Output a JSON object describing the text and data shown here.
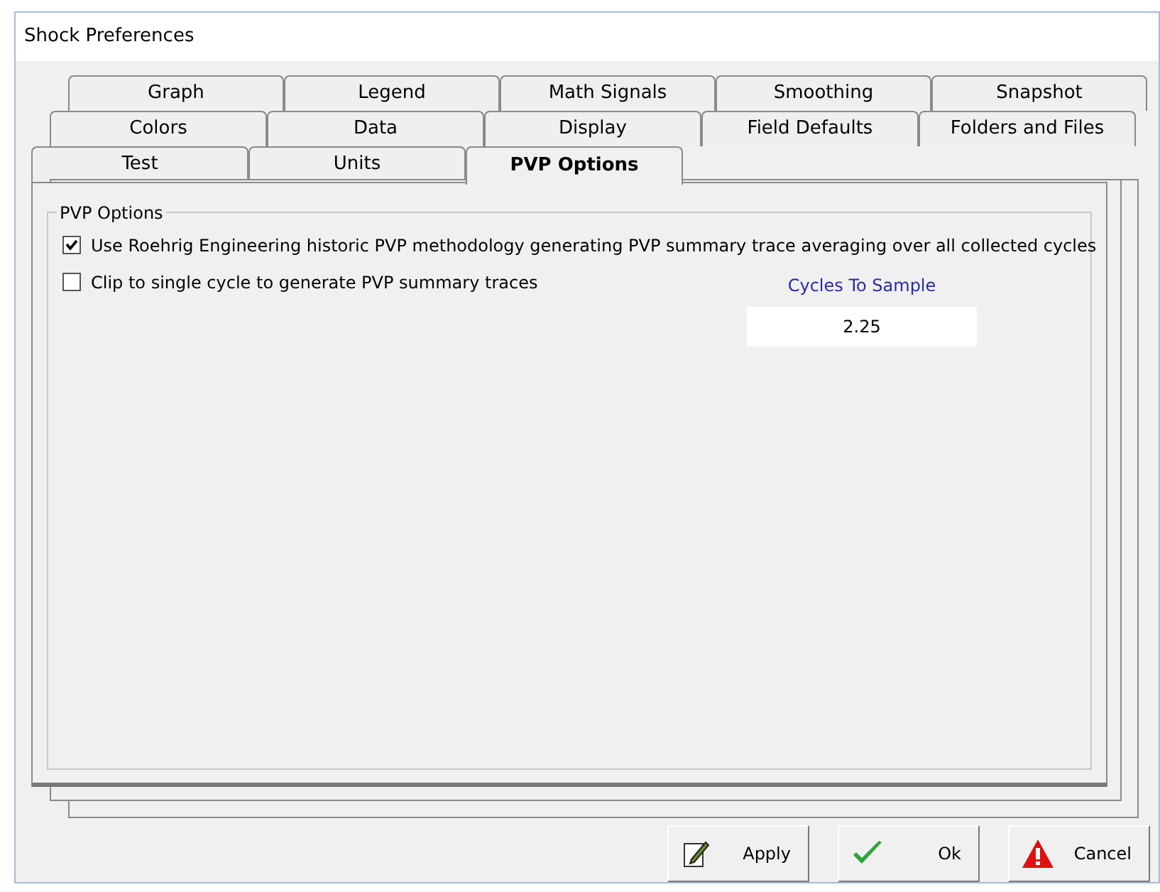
{
  "window": {
    "title": "Shock Preferences"
  },
  "tab_rows": [
    [
      {
        "label": "Graph",
        "selected": false
      },
      {
        "label": "Legend",
        "selected": false
      },
      {
        "label": "Math Signals",
        "selected": false
      },
      {
        "label": "Smoothing",
        "selected": false
      },
      {
        "label": "Snapshot",
        "selected": false
      }
    ],
    [
      {
        "label": "Colors",
        "selected": false
      },
      {
        "label": "Data",
        "selected": false
      },
      {
        "label": "Display",
        "selected": false
      },
      {
        "label": "Field Defaults",
        "selected": false
      },
      {
        "label": "Folders and Files",
        "selected": false
      }
    ],
    [
      {
        "label": "Test",
        "selected": false
      },
      {
        "label": "Units",
        "selected": false
      },
      {
        "label": "PVP Options",
        "selected": true
      }
    ]
  ],
  "group": {
    "title": "PVP Options",
    "options": [
      {
        "label": "Use Roehrig Engineering historic PVP methodology generating PVP summary trace averaging over all collected cycles",
        "checked": true
      },
      {
        "label": "Clip to single cycle to generate PVP summary traces",
        "checked": false
      }
    ],
    "cycles_field": {
      "label": "Cycles To Sample",
      "value": "2.25"
    }
  },
  "buttons": [
    {
      "kind": "apply",
      "label": "Apply"
    },
    {
      "kind": "ok",
      "label": "Ok"
    },
    {
      "kind": "cancel",
      "label": "Cancel"
    }
  ]
}
